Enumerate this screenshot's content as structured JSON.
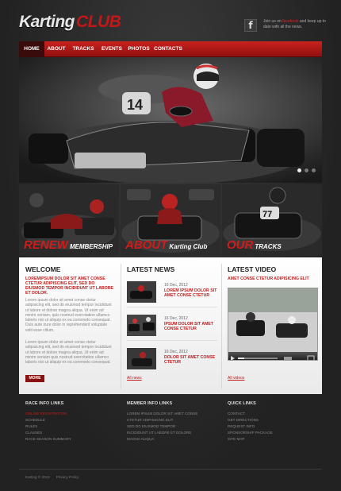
{
  "header": {
    "logo_part1": "Karting",
    "logo_part2": "CLUB",
    "facebook_icon_letter": "f",
    "facebook_text_pre": "Join us on ",
    "facebook_text_link": "facebook",
    "facebook_text_post": " and keep up to date with all the news."
  },
  "nav": {
    "items": [
      {
        "label": "HOME",
        "active": true
      },
      {
        "label": "ABOUT",
        "active": false
      },
      {
        "label": "TRACKS",
        "active": false
      },
      {
        "label": "EVENTS",
        "active": false
      },
      {
        "label": "PHOTOS",
        "active": false
      },
      {
        "label": "CONTACTS",
        "active": false
      }
    ]
  },
  "hero": {
    "kart_number": "14",
    "slides_total": 3,
    "active_slide": 1
  },
  "promos": [
    {
      "big": "Renew",
      "small": "MEMBERSHIP",
      "kart_number": ""
    },
    {
      "big": "About",
      "small": "Karting Club",
      "kart_number": ""
    },
    {
      "big": "Our",
      "small": "TRACKS",
      "kart_number": "77"
    }
  ],
  "welcome": {
    "title": "WELCOME",
    "lead": "LOREMIPSUM DOLOR SIT AMET CONSE CTETUR ADIPISCING ELIT, SED DO EIUSMOD TEMPOR INCIDIDUNT UT LABORE ET DOLOR.",
    "para1": "Lorem ipsum dolor sit amet conse ctetur adipisicing elit, sed do eiusmod tempor incididunt ut labore et dolore magna aliqua. Ut enim ad minim veniam, quis nostrud exercitation ullamco laboris nisi ut aliquip ex ea commodo consequat. Duis aute irure dolor in reprehenderit voluptate velit esse cillum.",
    "para2": "Lorem ipsum dolor sit amet conse ctetur adipisicing elit, sed do eiusmod tempor incididunt ut labore et dolore magna aliqua. Ut enim ad minim veniam quis nostrud exercitation ullamco laboris nisi ut aliquip ex ea commodo consequat.",
    "button": "MORE"
  },
  "news": {
    "title": "LATEST NEWS",
    "items": [
      {
        "date": "16 Dec, 2012",
        "title": "LOREM IPSUM DOLOR SIT AMET CONSE CTETUR"
      },
      {
        "date": "16 Dec, 2012",
        "title": "IPSUM DOLOR SIT AMET CONSE CTETUR"
      },
      {
        "date": "16 Dec, 2012",
        "title": "DOLOR SIT AMET CONSE CTETUR"
      }
    ],
    "all_link": "All news"
  },
  "video": {
    "title": "LATEST VIDEO",
    "caption": "AMET CONSE CTETUR ADIPISICING ELIT",
    "all_link": "All videos"
  },
  "footer": {
    "cols": [
      {
        "title": "RACE INFO LINKS",
        "links": [
          "ONLINE REGISTRATION",
          "SCHEDULE",
          "RULES",
          "CLASSES",
          "RACE SEASON SUMMARY"
        ],
        "active_index": 0
      },
      {
        "title": "MEMBER INFO LINKS",
        "links": [
          "LOREM IPSUM DOLOR SIT AMET CONSE",
          "CTETUR ADIPISICING ELIT",
          "SED DO EIUSMOD TEMPOR",
          "INCIDIDUNT UT LABORE ET DOLORE",
          "MAGNA ALIQUA"
        ],
        "active_index": -1
      },
      {
        "title": "QUICK LINKS",
        "links": [
          "CONTACT",
          "GET DIRECTIONS",
          "REQUEST INFO",
          "SPONSORSHIP PACKAGE",
          "SITE MAP"
        ],
        "active_index": -1
      }
    ],
    "copyright": "Karting © 2012",
    "privacy": "Privacy Policy"
  },
  "colors": {
    "accent": "#c51717",
    "nav_active": "#3a0b0b",
    "content_bg": "#ffffff"
  }
}
